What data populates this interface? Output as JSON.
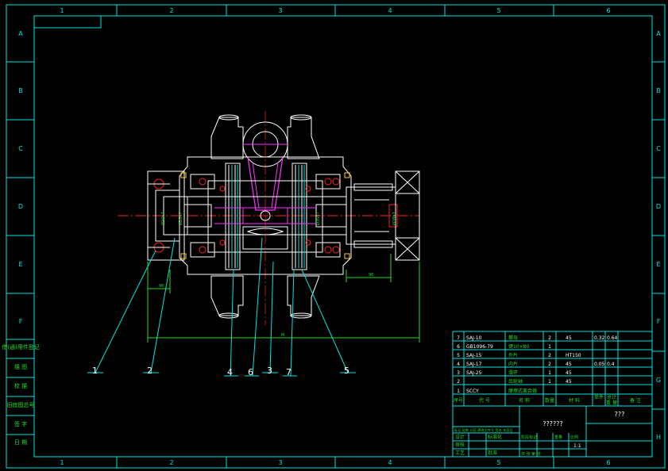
{
  "border": {
    "col_labels": [
      "1",
      "2",
      "3",
      "4",
      "5",
      "6"
    ],
    "row_labels_left": [
      "A",
      "B",
      "C",
      "D",
      "E",
      "F"
    ],
    "row_labels_right": [
      "A",
      "B",
      "C",
      "D",
      "E",
      "F",
      "G",
      "H"
    ],
    "bottom_col_labels": [
      "1",
      "2",
      "3",
      "4",
      "5",
      "6"
    ]
  },
  "side_stamp": [
    "借(通)用件登记",
    "描 图",
    "校 描",
    "旧底图总号",
    "签 字",
    "日 期"
  ],
  "drawing": {
    "dimensions": [
      "Ø30h7",
      "Ø35h7",
      "Ø35h7",
      "Ø28h7",
      "96",
      "96",
      "Ø35h7",
      "Ø28h7",
      "M"
    ],
    "leaders": [
      "1",
      "2",
      "4",
      "6",
      "3",
      "7",
      "5"
    ]
  },
  "bom": {
    "rows": [
      {
        "no": "7",
        "code": "SAJ-10",
        "name": "螺母",
        "qty": "2",
        "material": "45",
        "w1": "0.32",
        "w2": "0.64",
        "note": ""
      },
      {
        "no": "6",
        "code": "GB1096-79",
        "name": "键10×80",
        "qty": "1",
        "material": "",
        "w1": "",
        "w2": "",
        "note": ""
      },
      {
        "no": "5",
        "code": "SAJ-15",
        "name": "外片",
        "qty": "2",
        "material": "HT150",
        "w1": "",
        "w2": "",
        "note": ""
      },
      {
        "no": "4",
        "code": "SAJ-17",
        "name": "内片",
        "qty": "2",
        "material": "45",
        "w1": "0.05",
        "w2": "0.4",
        "note": ""
      },
      {
        "no": "3",
        "code": "SAJ-25",
        "name": "滑环",
        "qty": "1",
        "material": "45",
        "w1": "",
        "w2": "",
        "note": ""
      },
      {
        "no": "2",
        "code": "",
        "name": "齿轮轴",
        "qty": "1",
        "material": "45",
        "w1": "",
        "w2": "",
        "note": ""
      },
      {
        "no": "1",
        "code": "SCCY",
        "name": "摩擦式离合器",
        "qty": "",
        "material": "",
        "w1": "",
        "w2": "",
        "note": ""
      }
    ],
    "header": [
      "序号",
      "代 号",
      "名 称",
      "数量",
      "材 料",
      "单件",
      "总计",
      "重 量",
      "备 注"
    ],
    "title_main": "??????",
    "title_right": "???",
    "sign_left": "标记 处数 分区 更改文件号 签名 年月日",
    "row_design": "设计",
    "row_std": "标准化",
    "row_check": "审核",
    "row_proc": "工艺",
    "row_approve": "批准",
    "stage_label": "阶段标记",
    "weight_label": "重量",
    "scale_label": "比例",
    "scale_value": "1:1",
    "sheet_label": "共 张 第 张"
  },
  "colors": {
    "background": "#000000",
    "frame": "#00e5e5",
    "outline": "#ffffff",
    "hatch": "#ffd21a",
    "center": "#ff2020",
    "part": "#ff33ff",
    "dim": "#22dd22"
  }
}
